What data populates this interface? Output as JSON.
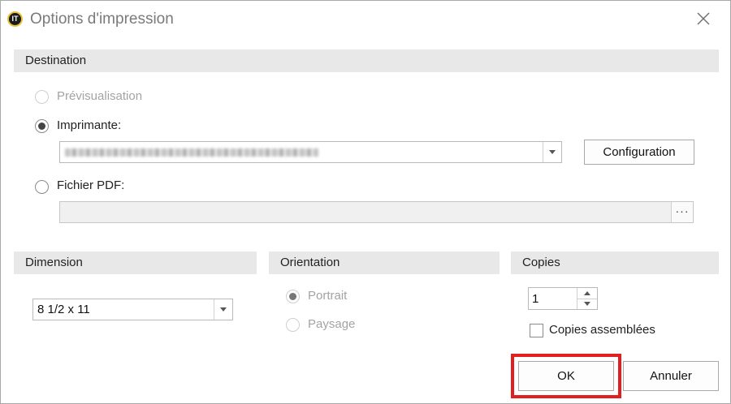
{
  "window": {
    "title": "Options d'impression",
    "app_icon": "app-logo-icon",
    "close_icon": "close-icon"
  },
  "destination": {
    "header": "Destination",
    "preview_label": "Prévisualisation",
    "printer_label": "Imprimante:",
    "printer_value": "",
    "configuration_button": "Configuration",
    "pdf_label": "Fichier PDF:",
    "pdf_value": "",
    "browse_button": "···",
    "selected": "printer"
  },
  "dimension": {
    "header": "Dimension",
    "value": "8 1/2 x 11"
  },
  "orientation": {
    "header": "Orientation",
    "portrait_label": "Portrait",
    "landscape_label": "Paysage",
    "selected": "portrait"
  },
  "copies": {
    "header": "Copies",
    "value": "1",
    "collate_label": "Copies assemblées",
    "collate_checked": false
  },
  "buttons": {
    "ok": "OK",
    "cancel": "Annuler"
  },
  "colors": {
    "highlight": "#e02020",
    "header_bg": "#e8e8e8"
  }
}
